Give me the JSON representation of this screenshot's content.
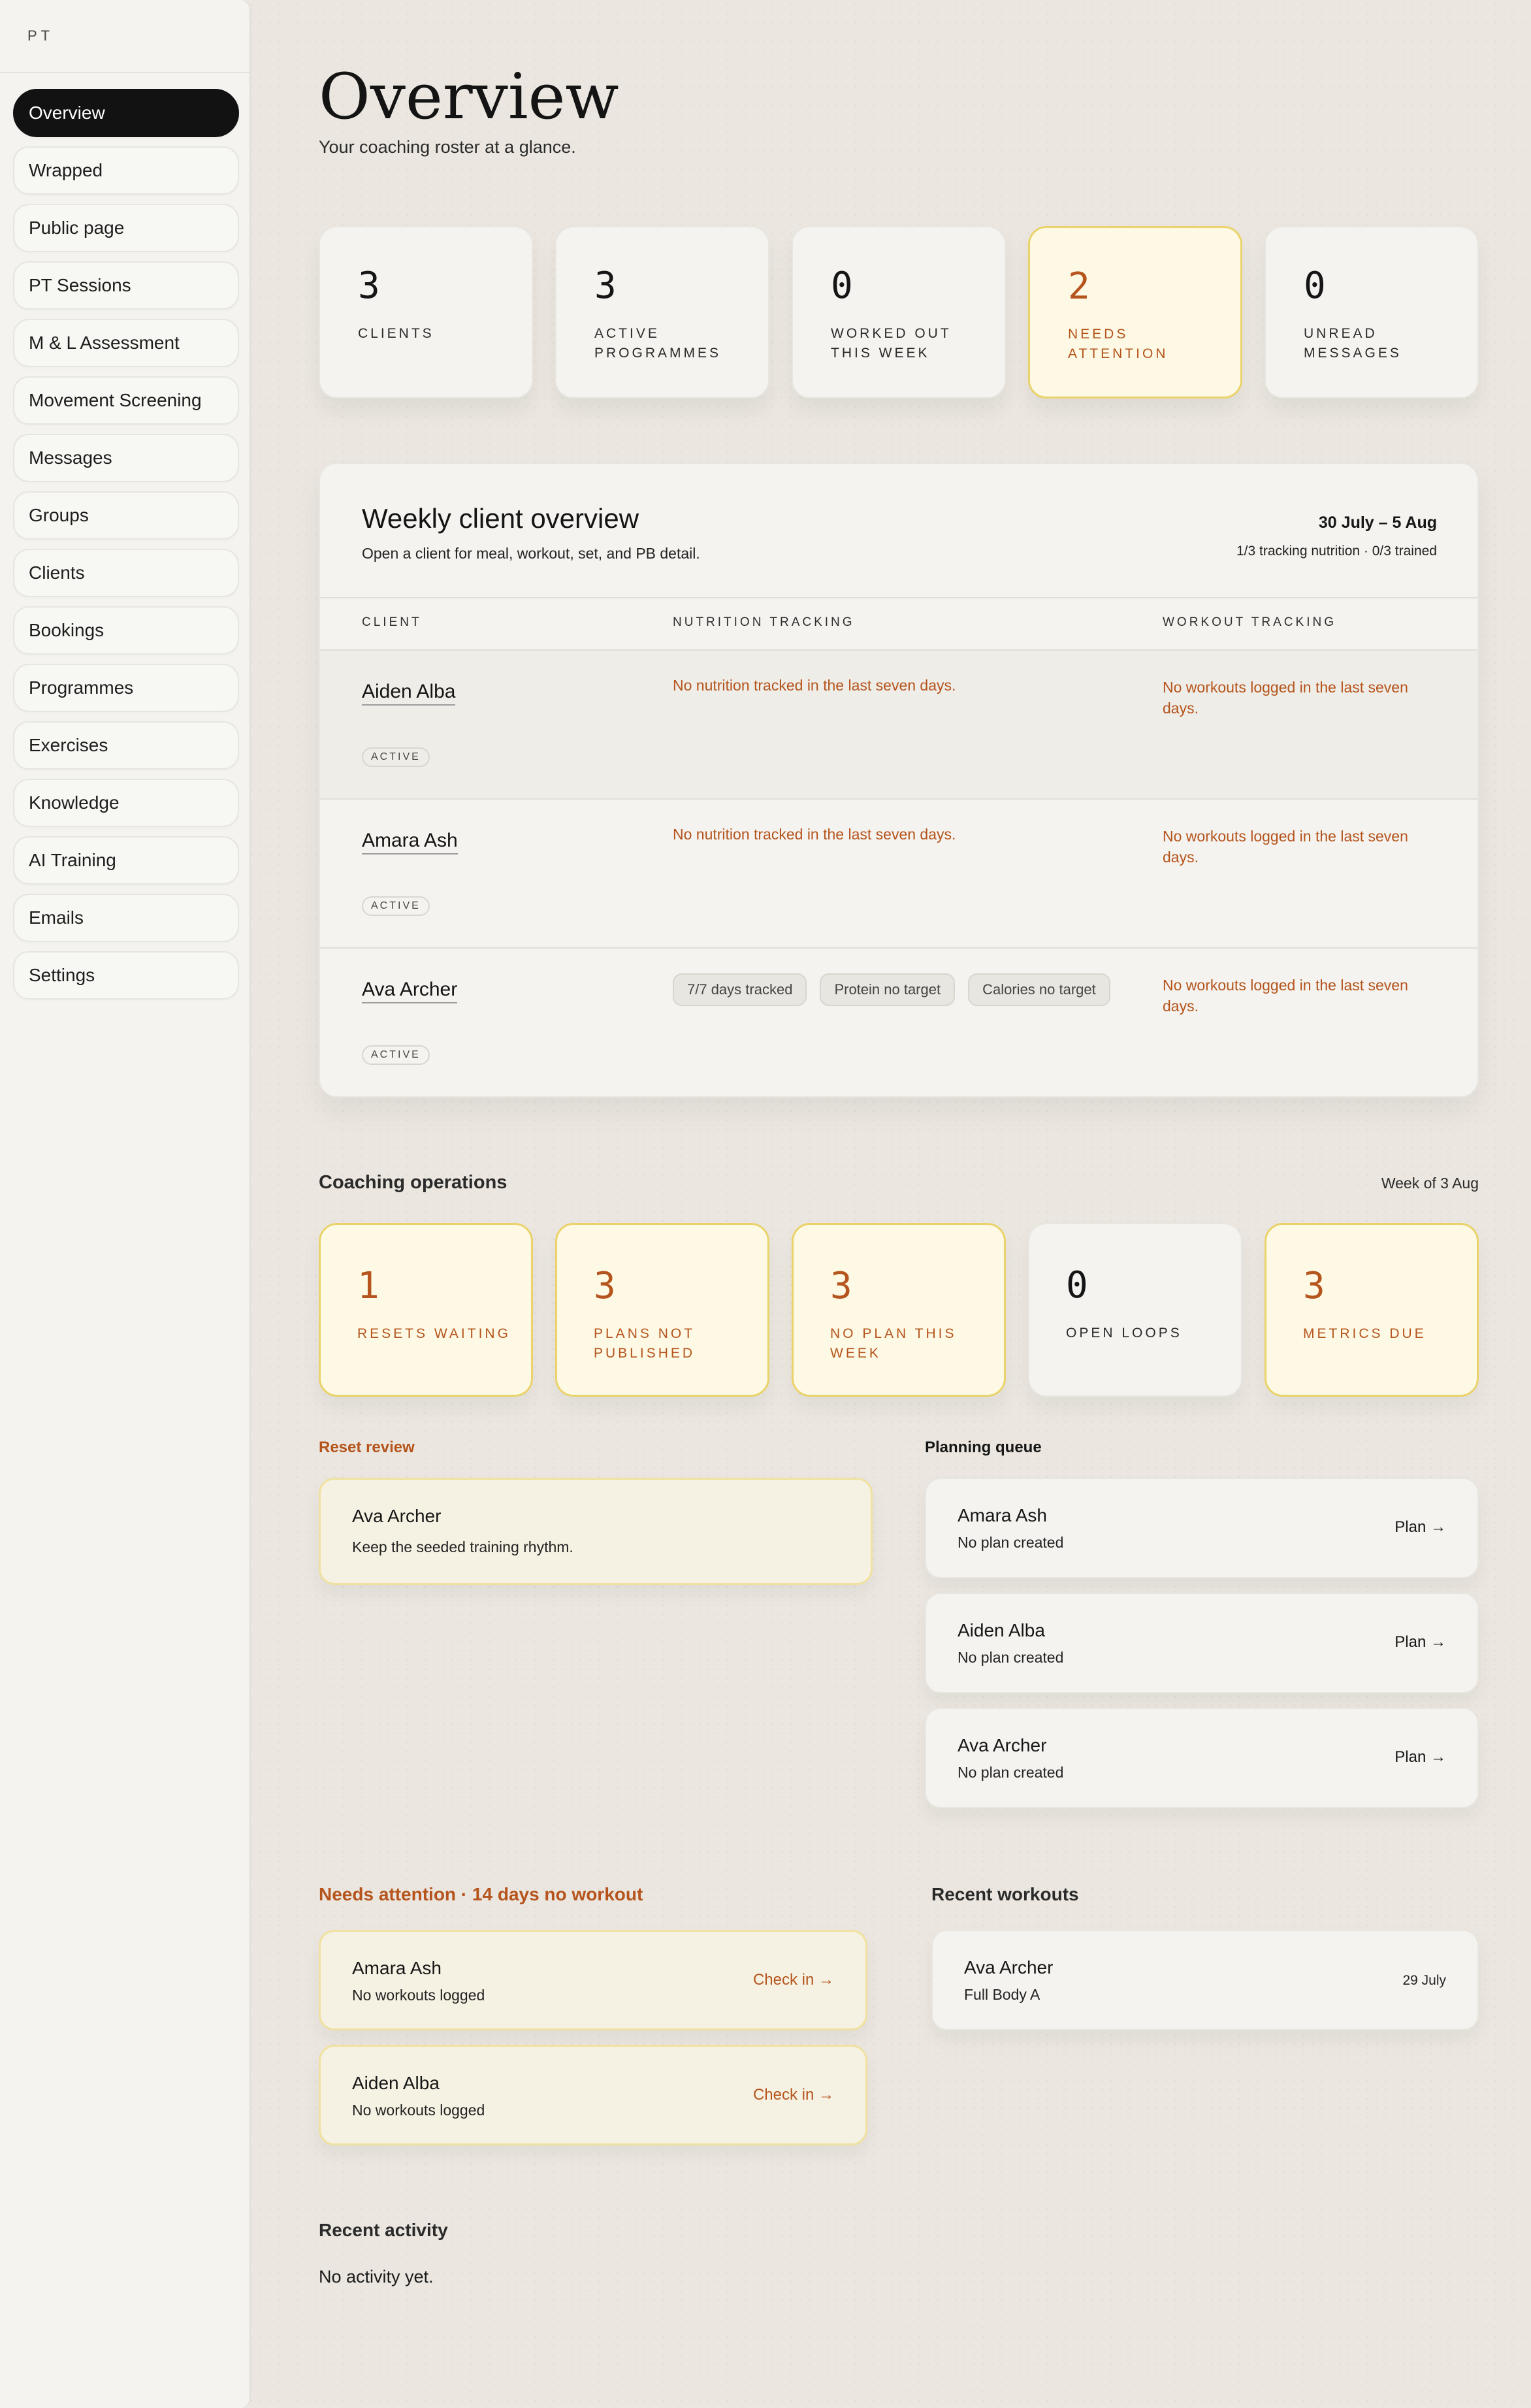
{
  "sidebar": {
    "brand": "PT",
    "items": [
      {
        "label": "Overview",
        "active": true
      },
      {
        "label": "Wrapped"
      },
      {
        "label": "Public page"
      },
      {
        "label": "PT Sessions"
      },
      {
        "label": "M & L Assessment"
      },
      {
        "label": "Movement Screening"
      },
      {
        "label": "Messages"
      },
      {
        "label": "Groups"
      },
      {
        "label": "Clients"
      },
      {
        "label": "Bookings"
      },
      {
        "label": "Programmes"
      },
      {
        "label": "Exercises"
      },
      {
        "label": "Knowledge"
      },
      {
        "label": "AI Training"
      },
      {
        "label": "Emails"
      },
      {
        "label": "Settings"
      }
    ]
  },
  "header": {
    "title": "Overview",
    "subtitle": "Your coaching roster at a glance."
  },
  "stats": [
    {
      "value": "3",
      "label": "Clients"
    },
    {
      "value": "3",
      "label": "Active programmes"
    },
    {
      "value": "0",
      "label": "Worked out this week"
    },
    {
      "value": "2",
      "label": "Needs attention",
      "highlight": true
    },
    {
      "value": "0",
      "label": "Unread messages"
    }
  ],
  "weekly": {
    "title": "Weekly client overview",
    "subtitle": "Open a client for meal, workout, set, and PB detail.",
    "range": "30 July – 5 Aug",
    "summary": "1/3 tracking nutrition · 0/3 trained",
    "columns": [
      "Client",
      "Nutrition tracking",
      "Workout tracking"
    ],
    "rows": [
      {
        "name": "Aiden Alba",
        "status": "Active",
        "nutrition": "No nutrition tracked in the last seven days.",
        "workout": "No workouts logged in the last seven days."
      },
      {
        "name": "Amara Ash",
        "status": "Active",
        "nutrition": "No nutrition tracked in the last seven days.",
        "workout": "No workouts logged in the last seven days."
      },
      {
        "name": "Ava Archer",
        "status": "Active",
        "chips": [
          "7/7 days tracked",
          "Protein no target",
          "Calories no target"
        ],
        "workout": "No workouts logged in the last seven days."
      }
    ]
  },
  "operations": {
    "title": "Coaching operations",
    "week": "Week of 3 Aug",
    "cards": [
      {
        "value": "1",
        "label": "Resets waiting"
      },
      {
        "value": "3",
        "label": "Plans not published"
      },
      {
        "value": "3",
        "label": "No plan this week"
      },
      {
        "value": "0",
        "label": "Open loops",
        "neutral": true
      },
      {
        "value": "3",
        "label": "Metrics due"
      }
    ]
  },
  "reset_review": {
    "title": "Reset review",
    "items": [
      {
        "name": "Ava Archer",
        "note": "Keep the seeded training rhythm."
      }
    ]
  },
  "planning_queue": {
    "title": "Planning queue",
    "items": [
      {
        "name": "Amara Ash",
        "note": "No plan created",
        "action": "Plan →"
      },
      {
        "name": "Aiden Alba",
        "note": "No plan created",
        "action": "Plan →"
      },
      {
        "name": "Ava Archer",
        "note": "No plan created",
        "action": "Plan →"
      }
    ]
  },
  "needs_attention": {
    "title": "Needs attention · 14 days no workout",
    "items": [
      {
        "name": "Amara Ash",
        "note": "No workouts logged",
        "action": "Check in →"
      },
      {
        "name": "Aiden Alba",
        "note": "No workouts logged",
        "action": "Check in →"
      }
    ]
  },
  "recent_workouts": {
    "title": "Recent workouts",
    "items": [
      {
        "name": "Ava Archer",
        "note": "Full Body A",
        "date": "29 July"
      }
    ]
  },
  "recent_activity": {
    "title": "Recent activity",
    "empty": "No activity yet."
  },
  "colors": {
    "accent": "#b5541c",
    "highlight_bg": "#fdf9e4",
    "highlight_border": "#ead36a",
    "nav_active": "#121212"
  }
}
